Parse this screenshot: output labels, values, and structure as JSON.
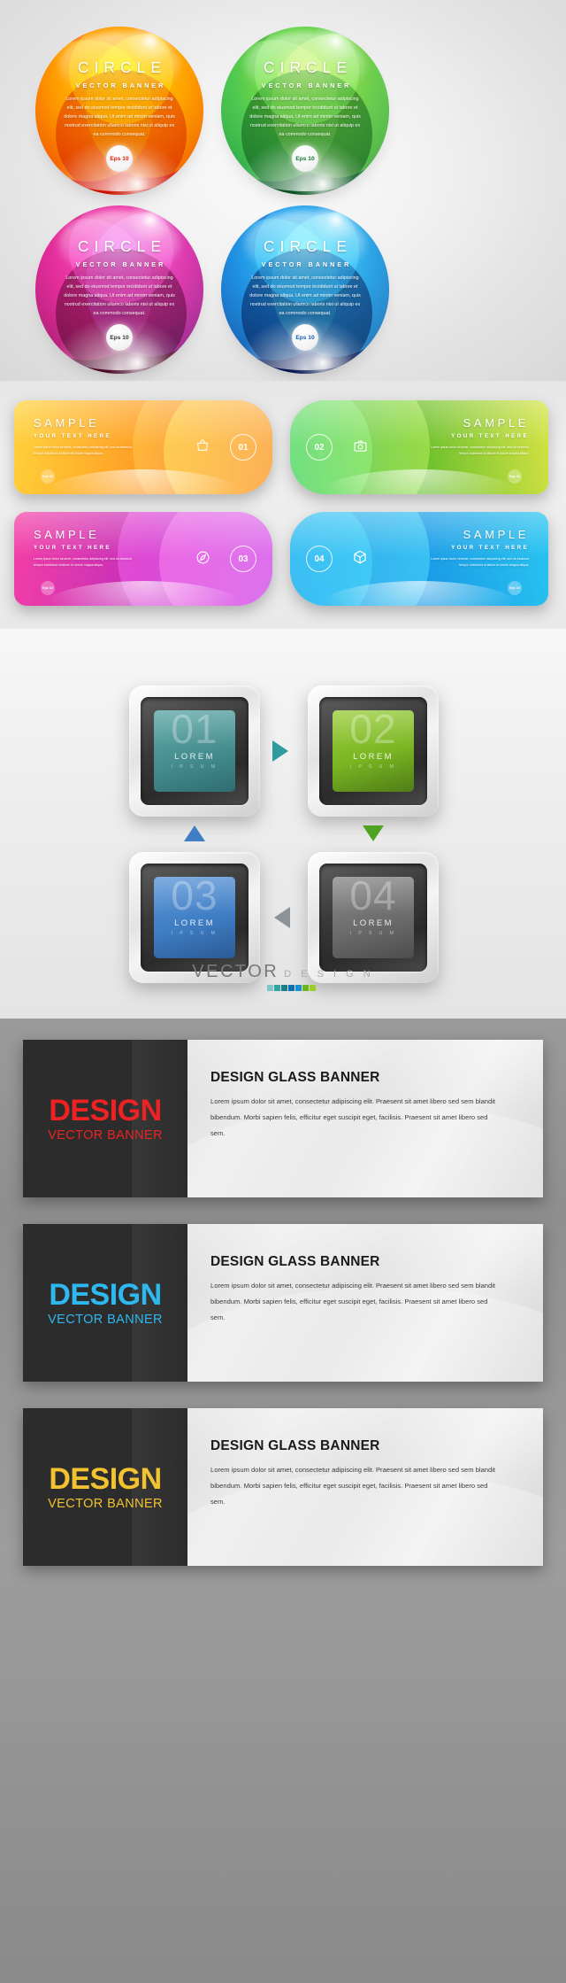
{
  "section_circles": {
    "name": "circle-vector-banners",
    "items": [
      {
        "id": "orange",
        "title": "CIRCLE",
        "subtitle": "VECTOR BANNER",
        "body": "Lorem ipsum dolor sit amet, consectetur adipiscing elit, sed do eiusmod tempor incididunt ut labore et dolore magna aliqua. Ut enim ad minim veniam, quis nostrud exercitation ullamco laboris nisi ut aliquip ex ea commodo consequat.",
        "badge": "Eps 10",
        "colors": {
          "outer": "#ffe000",
          "mid": "#ff8a00",
          "core": "#e02000",
          "accent": "#ff5a00"
        }
      },
      {
        "id": "green",
        "title": "CIRCLE",
        "subtitle": "VECTOR BANNER",
        "body": "Lorem ipsum dolor sit amet, consectetur adipiscing elit, sed do eiusmod tempor incididunt ut labore et dolore magna aliqua. Ut enim ad minim veniam, quis nostrud exercitation ullamco laboris nisi ut aliquip ex ea commodo consequat.",
        "badge": "Eps 10",
        "colors": {
          "outer": "#9ad32a",
          "mid": "#43b02a",
          "core": "#046a2d",
          "accent": "#7ac943"
        }
      },
      {
        "id": "pink",
        "title": "CIRCLE",
        "subtitle": "VECTOR BANNER",
        "body": "Lorem ipsum dolor sit amet, consectetur adipiscing elit, sed do eiusmod tempor incididunt ut labore et dolore magna aliqua. Ut enim ad minim veniam, quis nostrud exercitation ullamco laboris nisi ut aliquip ex ea commodo consequat.",
        "badge": "Eps 10",
        "colors": {
          "outer": "#8e44c8",
          "mid": "#e8187f",
          "core": "#5c1140",
          "accent": "#ff4fa0"
        }
      },
      {
        "id": "blue",
        "title": "CIRCLE",
        "subtitle": "VECTOR BANNER",
        "body": "Lorem ipsum dolor sit amet, consectetur adipiscing elit, sed do eiusmod tempor incididunt ut labore et dolore magna aliqua. Ut enim ad minim veniam, quis nostrud exercitation ullamco laboris nisi ut aliquip ex ea commodo consequat.",
        "badge": "Eps 10",
        "colors": {
          "outer": "#2fa7f0",
          "mid": "#1565d8",
          "core": "#071d5e",
          "accent": "#36c4f5"
        }
      }
    ]
  },
  "section_sample": {
    "name": "sample-infographic-banners",
    "items": [
      {
        "id": "orange",
        "title": "SAMPLE",
        "subtitle": "YOUR TEXT HERE",
        "body": "Lorem ipsum dolor sit amet, consectetur adipiscing elit, sed do eiusmod tempor incididunt ut labore et dolore magna aliqua.",
        "number": "01",
        "badge": "Eps 10",
        "icon": "bag-icon",
        "align": "left",
        "colors": {
          "from": "#ffd23a",
          "to": "#f2542d"
        }
      },
      {
        "id": "green",
        "title": "SAMPLE",
        "subtitle": "YOUR TEXT HERE",
        "body": "Lorem ipsum dolor sit amet, consectetur adipiscing elit, sed do eiusmod tempor incididunt ut labore et dolore magna aliqua.",
        "number": "02",
        "badge": "Eps 10",
        "icon": "camera-icon",
        "align": "right",
        "colors": {
          "from": "#1faa5a",
          "to": "#d6e342"
        }
      },
      {
        "id": "pink",
        "title": "SAMPLE",
        "subtitle": "YOUR TEXT HERE",
        "body": "Lorem ipsum dolor sit amet, consectetur adipiscing elit, sed do eiusmod tempor incididunt ut labore et dolore magna aliqua.",
        "number": "03",
        "badge": "Eps 10",
        "icon": "compass-icon",
        "align": "left",
        "colors": {
          "from": "#f43fa5",
          "to": "#8a3fd1"
        }
      },
      {
        "id": "blue",
        "title": "SAMPLE",
        "subtitle": "YOUR TEXT HERE",
        "body": "Lorem ipsum dolor sit amet, consectetur adipiscing elit, sed do eiusmod tempor incididunt ut labore et dolore magna aliqua.",
        "number": "04",
        "badge": "Eps 10",
        "icon": "cube-icon",
        "align": "right",
        "colors": {
          "from": "#28c4f0",
          "to": "#1273d4"
        }
      }
    ]
  },
  "section_squares": {
    "name": "glass-square-buttons",
    "items": [
      {
        "id": "s1",
        "number": "01",
        "label": "LOREM",
        "sublabel": "I P S U M",
        "color": "#4e9d9d"
      },
      {
        "id": "s2",
        "number": "02",
        "label": "LOREM",
        "sublabel": "I P S U M",
        "color": "#79b524"
      },
      {
        "id": "s3",
        "number": "03",
        "label": "LOREM",
        "sublabel": "I P S U M",
        "color": "#3f7ec4"
      },
      {
        "id": "s4",
        "number": "04",
        "label": "LOREM",
        "sublabel": "I P S U M",
        "color": "#6d6d6d"
      }
    ],
    "arrows": [
      {
        "id": "a1",
        "direction": "right",
        "color": "#2f9aa0"
      },
      {
        "id": "a2",
        "direction": "down",
        "color": "#4ea420"
      },
      {
        "id": "a3",
        "direction": "left",
        "color": "#8d9296"
      },
      {
        "id": "a4",
        "direction": "up",
        "color": "#3f7ec4"
      }
    ],
    "logo": {
      "vector": "VECTOR",
      "design": "D E S I G N",
      "bar_colors": [
        "#7fc6c6",
        "#2fa3a3",
        "#1b7f8a",
        "#0f6fb5",
        "#1a8fd0",
        "#6ab51e",
        "#9ccf22"
      ]
    }
  },
  "section_dark": {
    "name": "design-glass-banners",
    "items": [
      {
        "id": "red",
        "title": "DESIGN",
        "subtitle": "VECTOR BANNER",
        "accent": "#ee2222",
        "heading": "DESIGN GLASS BANNER",
        "body": "Lorem ipsum dolor sit amet, consectetur adipiscing elit. Praesent sit amet libero sed sem blandit bibendum. Morbi sapien felis, efficitur eget suscipit eget, facilisis. Praesent sit amet libero sed sem."
      },
      {
        "id": "blue",
        "title": "DESIGN",
        "subtitle": "VECTOR BANNER",
        "accent": "#2eb8f0",
        "heading": "DESIGN GLASS BANNER",
        "body": "Lorem ipsum dolor sit amet, consectetur adipiscing elit. Praesent sit amet libero sed sem blandit bibendum. Morbi sapien felis, efficitur eget suscipit eget, facilisis. Praesent sit amet libero sed sem."
      },
      {
        "id": "yellow",
        "title": "DESIGN",
        "subtitle": "VECTOR BANNER",
        "accent": "#f2c230",
        "heading": "DESIGN GLASS BANNER",
        "body": "Lorem ipsum dolor sit amet, consectetur adipiscing elit. Praesent sit amet libero sed sem blandit bibendum. Morbi sapien felis, efficitur eget suscipit eget, facilisis. Praesent sit amet libero sed sem."
      }
    ]
  }
}
